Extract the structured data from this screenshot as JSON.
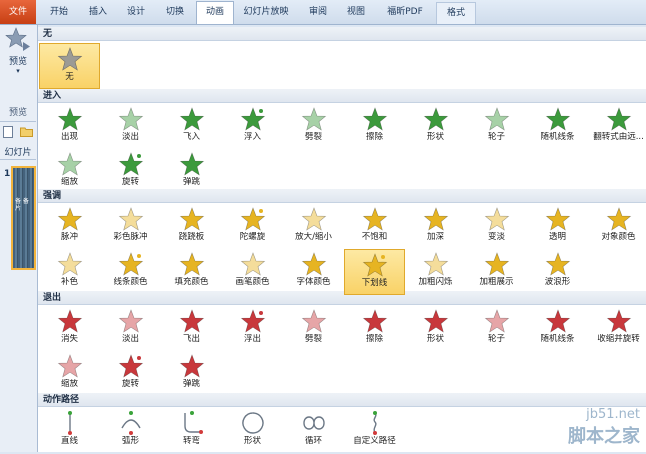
{
  "ribbon": {
    "tabs": [
      {
        "label": "文件"
      },
      {
        "label": "开始"
      },
      {
        "label": "插入"
      },
      {
        "label": "设计"
      },
      {
        "label": "切换"
      },
      {
        "label": "动画"
      },
      {
        "label": "幻灯片放映"
      },
      {
        "label": "审阅"
      },
      {
        "label": "视图"
      },
      {
        "label": "福昕PDF"
      },
      {
        "label": "格式"
      }
    ],
    "active_tab": "动画"
  },
  "left_panel": {
    "preview_label": "预览",
    "group_label": "预览",
    "slides_tab_label": "幻灯片",
    "slide_number": "1",
    "thumb_text": "备 备 片"
  },
  "gallery": {
    "sections": {
      "none": "无",
      "entrance": "进入",
      "emphasis": "强调",
      "exit": "退出",
      "motion": "动作路径"
    },
    "none_item": "无",
    "entrance": [
      "出现",
      "淡出",
      "飞入",
      "浮入",
      "劈裂",
      "擦除",
      "形状",
      "轮子",
      "随机线条",
      "翻转式由远...",
      "缩放",
      "旋转",
      "弹跳"
    ],
    "emphasis": [
      "脉冲",
      "彩色脉冲",
      "跷跷板",
      "陀螺旋",
      "放大/缩小",
      "不饱和",
      "加深",
      "变淡",
      "透明",
      "对象颜色",
      "补色",
      "线条颜色",
      "填充颜色",
      "画笔颜色",
      "字体颜色",
      "下划线",
      "加粗闪烁",
      "加粗展示",
      "波浪形"
    ],
    "emphasis_selected": "下划线",
    "exit": [
      "消失",
      "淡出",
      "飞出",
      "浮出",
      "劈裂",
      "擦除",
      "形状",
      "轮子",
      "随机线条",
      "收缩并旋转",
      "缩放",
      "旋转",
      "弹跳"
    ],
    "motion": [
      "直线",
      "弧形",
      "转弯",
      "形状",
      "循环",
      "自定义路径"
    ]
  },
  "colors": {
    "entrance_star": "#3c9a3c",
    "emphasis_star": "#e6b422",
    "exit_star": "#c8383c",
    "selected_bg": "#f9d267"
  },
  "watermark": {
    "line1": "jb51.net",
    "line2": "脚本之家"
  }
}
